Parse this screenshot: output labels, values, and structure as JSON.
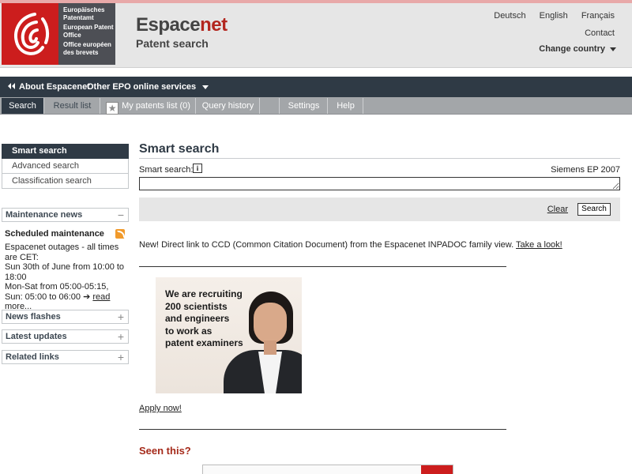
{
  "logo": {
    "line1": "Europäisches Patentamt",
    "line2": "European Patent Office",
    "line3": "Office européen des brevets"
  },
  "brand": {
    "title_main": "Espace",
    "title_accent": "net",
    "subtitle": "Patent search"
  },
  "languages": [
    "Deutsch",
    "English",
    "Français"
  ],
  "header": {
    "contact": "Contact",
    "change_country": "Change country"
  },
  "top_nav": {
    "about": "About Espacenet",
    "other": "Other EPO online services"
  },
  "tabs": [
    {
      "label": "Search"
    },
    {
      "label": "Result list"
    },
    {
      "label": "My patents list (0)"
    },
    {
      "label": "Query history"
    },
    {
      "label": ""
    },
    {
      "label": "Settings"
    },
    {
      "label": "Help"
    }
  ],
  "side_nav": [
    {
      "label": "Smart search"
    },
    {
      "label": "Advanced search"
    },
    {
      "label": "Classification search"
    }
  ],
  "panels": {
    "maintenance": "Maintenance news",
    "news": "News flashes",
    "latest": "Latest updates",
    "related": "Related links"
  },
  "maintenance": {
    "title": "Scheduled maintenance",
    "body1": "Espacenet outages - all times are CET:",
    "body2": "Sun 30th of June from 10:00 to 18:00",
    "body3": "Mon-Sat from 05:00-05:15,",
    "body4": "Sun: 05:00 to 06:00 ",
    "more": "read more..."
  },
  "main": {
    "title": "Smart search",
    "search_label": "Smart search:",
    "example": "Siemens EP 2007",
    "search_value": "",
    "clear": "Clear",
    "search_button": "Search",
    "news_text": "New! Direct link to CCD (Common Citation Document) from the Espacenet INPADOC family view. ",
    "news_link": "Take a look!",
    "recruit_text": [
      "We are recruiting",
      "200 scientists",
      "and engineers",
      "to work as",
      "patent examiners"
    ],
    "apply": "Apply now!",
    "seen_this": "Seen this?"
  },
  "colors": {
    "brand_red": "#cc1d1d",
    "dark_nav": "#2f3a45",
    "tab_bar": "#a3a6a9",
    "accent_red_text": "#b3261e"
  }
}
